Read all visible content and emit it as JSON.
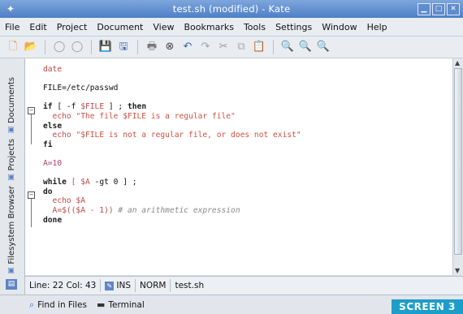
{
  "window": {
    "title": "test.sh (modified) - Kate"
  },
  "menu": [
    {
      "label": "File"
    },
    {
      "label": "Edit"
    },
    {
      "label": "Project"
    },
    {
      "label": "Document"
    },
    {
      "label": "View"
    },
    {
      "label": "Bookmarks"
    },
    {
      "label": "Tools"
    },
    {
      "label": "Settings"
    },
    {
      "label": "Window"
    },
    {
      "label": "Help"
    }
  ],
  "toolbar": [
    {
      "icon": "new-document-icon"
    },
    {
      "icon": "open-folder-icon"
    },
    {
      "icon": "back-icon"
    },
    {
      "icon": "forward-icon"
    },
    {
      "icon": "save-icon"
    },
    {
      "icon": "save-all-icon"
    },
    {
      "icon": "print-icon"
    },
    {
      "icon": "close-document-icon"
    },
    {
      "icon": "undo-icon"
    },
    {
      "icon": "redo-icon"
    },
    {
      "icon": "cut-icon"
    },
    {
      "icon": "copy-icon"
    },
    {
      "icon": "paste-icon"
    },
    {
      "icon": "find-icon"
    },
    {
      "icon": "find-replace-icon"
    },
    {
      "icon": "find-next-icon"
    }
  ],
  "sidebar": {
    "tabs": [
      {
        "label": "Documents"
      },
      {
        "label": "Projects"
      },
      {
        "label": "Filesystem Browser"
      }
    ]
  },
  "editor": {
    "lines": [
      {
        "parts": [
          {
            "t": "date",
            "c": "var"
          }
        ]
      },
      {
        "parts": []
      },
      {
        "parts": [
          {
            "t": "FILE=/etc/passwd",
            "c": ""
          }
        ]
      },
      {
        "parts": []
      },
      {
        "parts": [
          {
            "t": "if",
            "c": "kw"
          },
          {
            "t": " [ -f ",
            "c": ""
          },
          {
            "t": "$FILE",
            "c": "var"
          },
          {
            "t": " ] ; ",
            "c": ""
          },
          {
            "t": "then",
            "c": "kw"
          }
        ]
      },
      {
        "parts": [
          {
            "t": "  echo ",
            "c": "var"
          },
          {
            "t": "\"The file $FILE is a regular file\"",
            "c": "str"
          }
        ]
      },
      {
        "parts": [
          {
            "t": "else",
            "c": "kw"
          }
        ]
      },
      {
        "parts": [
          {
            "t": "  echo ",
            "c": "var"
          },
          {
            "t": "\"$FILE is not a regular file, or does not exist\"",
            "c": "str"
          }
        ]
      },
      {
        "parts": [
          {
            "t": "fi",
            "c": "kw"
          }
        ]
      },
      {
        "parts": []
      },
      {
        "parts": [
          {
            "t": "A=10",
            "c": "num"
          }
        ]
      },
      {
        "parts": []
      },
      {
        "parts": [
          {
            "t": "while",
            "c": "kw"
          },
          {
            "t": " [ ",
            "c": "var"
          },
          {
            "t": "$A",
            "c": "var"
          },
          {
            "t": " -gt 0 ] ;",
            "c": ""
          }
        ]
      },
      {
        "parts": [
          {
            "t": "do",
            "c": "kw"
          }
        ]
      },
      {
        "parts": [
          {
            "t": "  echo $A",
            "c": "var"
          }
        ]
      },
      {
        "parts": [
          {
            "t": "  A=$(($A - 1))",
            "c": "var"
          },
          {
            "t": " # an arithmetic expression",
            "c": "cmt"
          }
        ]
      },
      {
        "parts": [
          {
            "t": "done",
            "c": "kw"
          }
        ]
      }
    ]
  },
  "status": {
    "position": "Line: 22 Col: 43",
    "mode": "INS",
    "norm": "NORM",
    "file": "test.sh"
  },
  "bottom": {
    "tabs": [
      {
        "label": "Find in Files",
        "icon": "find-in-files-icon"
      },
      {
        "label": "Terminal",
        "icon": "terminal-icon"
      }
    ]
  },
  "badge": {
    "label": "SCREEN 3"
  },
  "colors": {
    "titlebar": "#4d7fc7",
    "badge": "#1d9dc9",
    "keyword": "#1c1c1c",
    "variable": "#c34a4a",
    "string": "#d05040"
  }
}
